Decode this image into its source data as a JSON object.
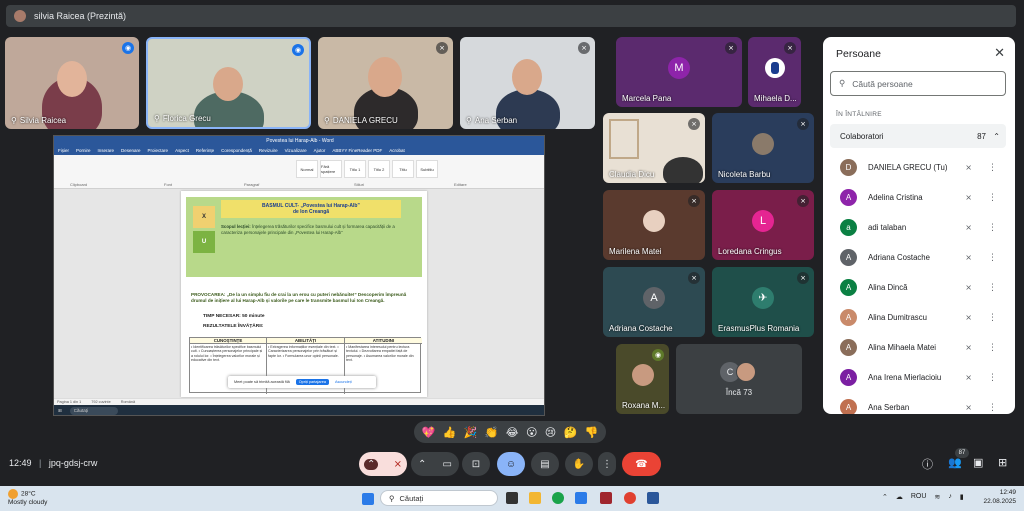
{
  "topbar": {
    "presenter": "silvia Raicea (Prezintă)"
  },
  "tiles": {
    "silvia": {
      "name": "Silvia Raicea"
    },
    "florica": {
      "name": "Florica Grecu"
    },
    "daniela": {
      "name": "DANIELA GRECU"
    },
    "ana": {
      "name": "Ana Serban"
    },
    "marcela": {
      "name": "Marcela Pana",
      "letter": "M",
      "color": "#8e24aa"
    },
    "mihaela": {
      "name": "Mihaela D..."
    },
    "claudia": {
      "name": "Claudia Dicu"
    },
    "nicoleta": {
      "name": "Nicoleta Barbu"
    },
    "marilena": {
      "name": "Marilena Matei"
    },
    "loredana": {
      "name": "Loredana Cringus",
      "letter": "L",
      "color": "#e52592"
    },
    "adriana": {
      "name": "Adriana Costache",
      "letter": "A",
      "color": "#5f6368"
    },
    "erasmus": {
      "name": "ErasmusPlus Romania"
    },
    "roxana": {
      "name": "Roxana M..."
    },
    "more": {
      "name": "Încă 73",
      "letter": "C"
    }
  },
  "shared": {
    "window_title": "Povestea lui Harap-Alb - Word",
    "menu": [
      "Fișier",
      "Pornire",
      "Inserare",
      "Desenare",
      "Proiectare",
      "Aspect",
      "Referințe",
      "Corespondență",
      "Revizuire",
      "Vizualizare",
      "Ajutor",
      "ABBYY FineReader PDF",
      "Acrobat"
    ],
    "styles": [
      "Normal",
      "Fără spațiere",
      "Titlu 1",
      "Titlu 2",
      "Titlu",
      "Subtitlu"
    ],
    "groups": [
      "Clipboard",
      "Font",
      "Paragraf",
      "Stiluri",
      "Editare"
    ],
    "doc": {
      "banner_line1": "BASMUL CULT- „Povestea lui Harap-Alb”",
      "banner_line2": "de Ion Creangă",
      "sq_x": "X",
      "sq_u": "U",
      "scop_title": "Scopul lecției:",
      "scop_text": "Înțelegerea trăsăturilor specifice basmului cult și formarea capacității de a caracteriza personajele principale din „Povestea lui Harap-Alb”",
      "provocare": "PROVOCAREA: „De la un simplu fiu de crai la un erou cu puteri nebănuite!” Descoperim împreună drumul de inițiere al lui Harap-Alb și valorile pe care le transmite basmul lui Ion Creangă.",
      "timp": "TIMP NECESAR: 50 minute",
      "rezultate": "REZULTATELE ÎNVĂȚĂRII:",
      "col1": "CUNOȘTINȚE",
      "col2": "ABILITĂȚI",
      "col3": "ATITUDINI",
      "cell1": "• Identificarea trăsăturilor specifice basmului cult. • Cunoașterea personajelor principale și a rolului lor. • Înțelegerea valorilor morale și educative din text.",
      "cell2": "• Extragerea informațiilor esențiale din text. • Caracterizarea personajelor prin trăsături și fapte lor. • Formularea unor opinii personale.",
      "cell3": "• Manifestarea interesului pentru lectura textului. • Dezvoltarea empatiei față de personaje. • Asumarea valorilor morale din text.",
      "popup": "Meet poate să trimită această filă",
      "popup_btn": "Opriți partajarea",
      "popup_link": "Ascundeți"
    },
    "status": [
      "Pagina 1 din 1",
      "792 cuvinte",
      "Română"
    ],
    "task_search": "Căutați"
  },
  "panel": {
    "title": "Persoane",
    "search_placeholder": "Căută persoane",
    "section": "ÎN ÎNTÂLNIRE",
    "group": "Colaboratori",
    "group_count": "87",
    "people": [
      {
        "name": "DANIELA GRECU (Tu)",
        "initial": "D",
        "color": "#8a6d5a"
      },
      {
        "name": "Adelina Cristina",
        "initial": "A",
        "color": "#8e24aa"
      },
      {
        "name": "adi talaban",
        "initial": "a",
        "color": "#0b8043"
      },
      {
        "name": "Adriana Costache",
        "initial": "A",
        "color": "#5f6368"
      },
      {
        "name": "Alina Dincă",
        "initial": "A",
        "color": "#0b8043"
      },
      {
        "name": "Alina Dumitrascu",
        "initial": "A",
        "color": "#c98a6a"
      },
      {
        "name": "Alina Mihaela Matei",
        "initial": "A",
        "color": "#8a6d5a"
      },
      {
        "name": "Ana Irena Mierlacioiu",
        "initial": "A",
        "color": "#7b1fa2"
      },
      {
        "name": "Ana Serban",
        "initial": "A",
        "color": "#c07050"
      }
    ]
  },
  "reactions": [
    "💖",
    "👍",
    "🎉",
    "👏",
    "😂",
    "😮",
    "😢",
    "🤔",
    "👎"
  ],
  "bottom": {
    "time": "12:49",
    "separator": "|",
    "code": "jpq-gdsj-crw",
    "people_count": "87"
  },
  "taskbar": {
    "temp": "28°C",
    "weather": "Mostly cloudy",
    "search": "Căutați",
    "lang": "ROU",
    "clock_time": "12:49",
    "clock_date": "22.08.2025"
  }
}
